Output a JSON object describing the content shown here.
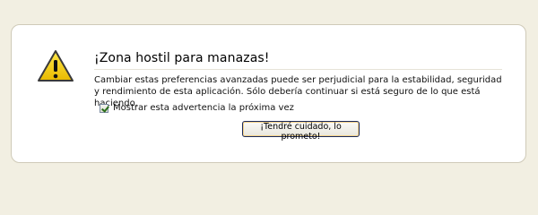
{
  "dialog": {
    "title": "¡Zona hostil para manazas!",
    "description": "Cambiar estas preferencias avanzadas puede ser perjudicial para la estabilidad, seguridad y rendimiento de esta aplicación. Sólo debería continuar si está seguro de lo que está haciendo.",
    "checkbox_label": "Mostrar esta advertencia la próxima vez",
    "checkbox_checked": true,
    "button_label": "¡Tendré cuidado, lo prometo!",
    "icon": "warning-icon"
  },
  "colors": {
    "background": "#f2efe2",
    "panel": "#ffffff",
    "warning_yellow": "#f6d40a"
  }
}
